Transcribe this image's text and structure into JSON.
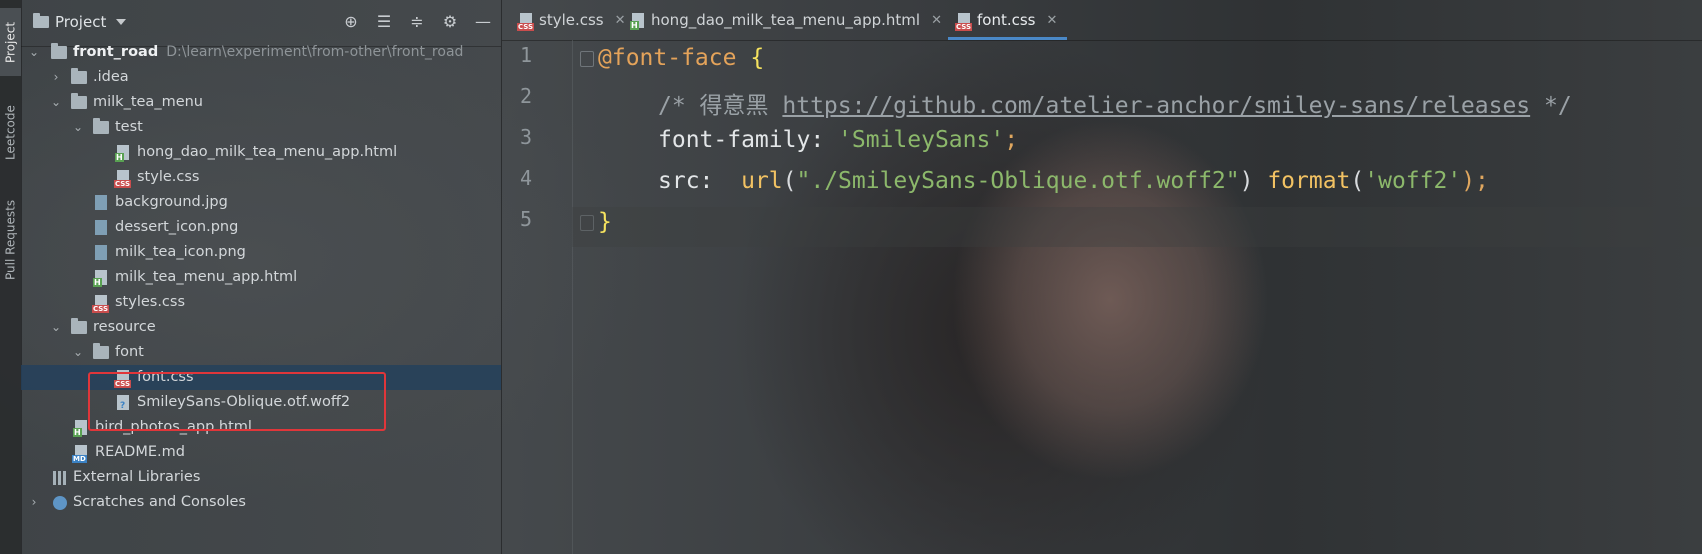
{
  "side_strip": {
    "tabs": [
      {
        "label": "Project",
        "icon": "folder-icon"
      },
      {
        "label": "Leetcode",
        "icon": "leetcode-icon"
      },
      {
        "label": "Pull Requests",
        "icon": "pull-request-icon"
      }
    ]
  },
  "project_panel": {
    "title": "Project",
    "tools": [
      "locate-icon",
      "expand-all-icon",
      "collapse-all-icon",
      "gear-icon",
      "minimize-icon"
    ],
    "root": {
      "name": "front_road",
      "path": "D:\\learn\\experiment\\from-other\\front_road"
    },
    "items": [
      {
        "label": ".idea"
      },
      {
        "label": "milk_tea_menu"
      },
      {
        "label": "test"
      },
      {
        "label": "hong_dao_milk_tea_menu_app.html"
      },
      {
        "label": "style.css"
      },
      {
        "label": "background.jpg"
      },
      {
        "label": "dessert_icon.png"
      },
      {
        "label": "milk_tea_icon.png"
      },
      {
        "label": "milk_tea_menu_app.html"
      },
      {
        "label": "styles.css"
      },
      {
        "label": "resource"
      },
      {
        "label": "font"
      },
      {
        "label": "font.css"
      },
      {
        "label": "SmileySans-Oblique.otf.woff2"
      },
      {
        "label": "bird_photos_app.html"
      },
      {
        "label": "README.md"
      },
      {
        "label": "External Libraries"
      },
      {
        "label": "Scratches and Consoles"
      }
    ]
  },
  "editor": {
    "tabs": [
      {
        "label": "style.css",
        "type": "css"
      },
      {
        "label": "hong_dao_milk_tea_menu_app.html",
        "type": "html"
      },
      {
        "label": "font.css",
        "type": "css",
        "active": true
      }
    ],
    "line_numbers": [
      "1",
      "2",
      "3",
      "4",
      "5"
    ],
    "code": {
      "l1_at": "@font-face",
      "l1_brace": "{",
      "l2_comment_open": "/* 得意黑 ",
      "l2_url": "https://github.com/atelier-anchor/smiley-sans/releases",
      "l2_comment_close": " */",
      "l3_prop": "font-family: ",
      "l3_value": "'SmileySans'",
      "l3_semi": ";",
      "l4_prop": "src:  ",
      "l4_fn": "url",
      "l4_lp": "(",
      "l4_arg": "\"./SmileySans-Oblique.otf.woff2\"",
      "l4_rp": ") ",
      "l4_fn2": "format",
      "l4_lp2": "(",
      "l4_arg2": "'woff2'",
      "l4_rp2": ");",
      "l5_brace": "}"
    }
  },
  "colors": {
    "selection": "#24415c",
    "tab_underline": "#4a88c7",
    "annotation_box": "#e0363a",
    "at_rule": "#e4a35a",
    "brace": "#f6e35f",
    "string": "#8cb86b"
  }
}
